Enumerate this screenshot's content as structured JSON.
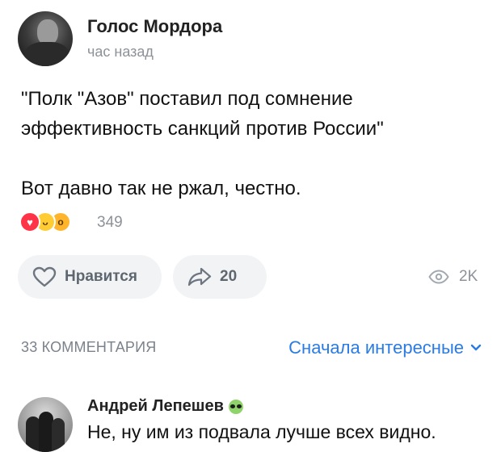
{
  "post": {
    "author": "Голос Мордора",
    "time": "час назад",
    "text_line1": "\"Полк \"Азов\" поставил под сомнение",
    "text_line2": "эффективность санкций против России\"",
    "text_line3": "Вот давно так не ржал, честно.",
    "reaction_count": "349"
  },
  "actions": {
    "like_label": "Нравится",
    "share_count": "20",
    "views": "2K"
  },
  "comments": {
    "count_label": "33 КОММЕНТАРИЯ",
    "sort_label": "Сначала интересные",
    "items": [
      {
        "author": "Андрей Лепешев",
        "text": "Не, ну им из подвала лучше всех видно."
      }
    ]
  },
  "colors": {
    "accent": "#2a7be4",
    "muted": "#8d9299",
    "button_bg": "#f2f3f5",
    "heart": "#ff3347"
  },
  "icons": [
    "heart-reaction-icon",
    "laugh-reaction-icon",
    "wow-reaction-icon",
    "heart-outline-icon",
    "share-arrow-icon",
    "eye-icon",
    "chevron-down-icon",
    "alien-emoji-icon"
  ]
}
